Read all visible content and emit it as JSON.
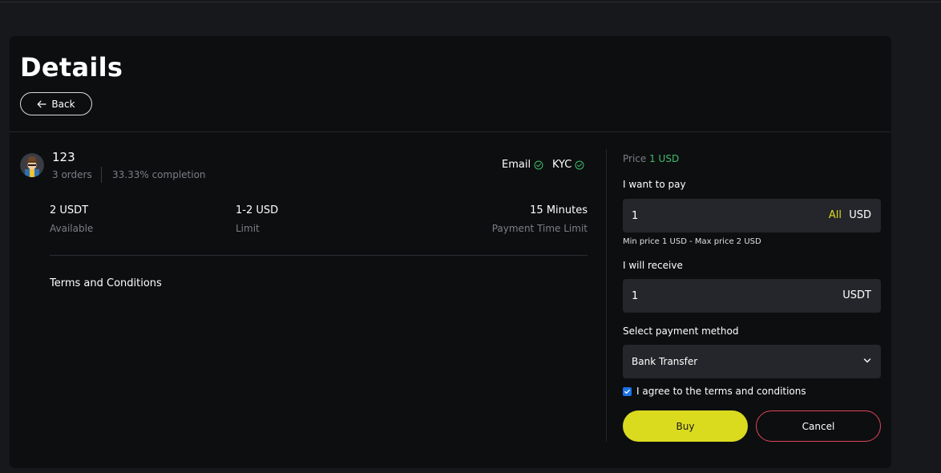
{
  "page": {
    "title": "Details",
    "back_label": "Back"
  },
  "user": {
    "name": "123",
    "orders": "3 orders",
    "completion": "33.33% completion",
    "verifications": [
      {
        "label": "Email",
        "icon": "check-circle-icon"
      },
      {
        "label": "KYC",
        "icon": "check-circle-icon"
      }
    ]
  },
  "stats": [
    {
      "value": "2 USDT",
      "label": "Available"
    },
    {
      "value": "1-2 USD",
      "label": "Limit"
    },
    {
      "value": "15 Minutes",
      "label": "Payment Time Limit"
    }
  ],
  "terms": {
    "title": "Terms and Conditions"
  },
  "order_form": {
    "price_label": "Price",
    "price_value": "1 USD",
    "pay_label": "I want to pay",
    "pay_value": "1",
    "pay_all": "All",
    "pay_unit": "USD",
    "min_max": "Min price 1 USD - Max price 2 USD",
    "receive_label": "I will receive",
    "receive_value": "1",
    "receive_unit": "USDT",
    "payment_method_label": "Select payment method",
    "payment_method_value": "Bank Transfer",
    "agree_label": "I agree to the terms and conditions",
    "agree_checked": true,
    "buy_label": "Buy",
    "cancel_label": "Cancel"
  },
  "colors": {
    "accent": "#dadb1f",
    "success": "#3fbd6b",
    "danger": "#e0455a",
    "panel": "#0d0e10",
    "input": "#25262b"
  }
}
